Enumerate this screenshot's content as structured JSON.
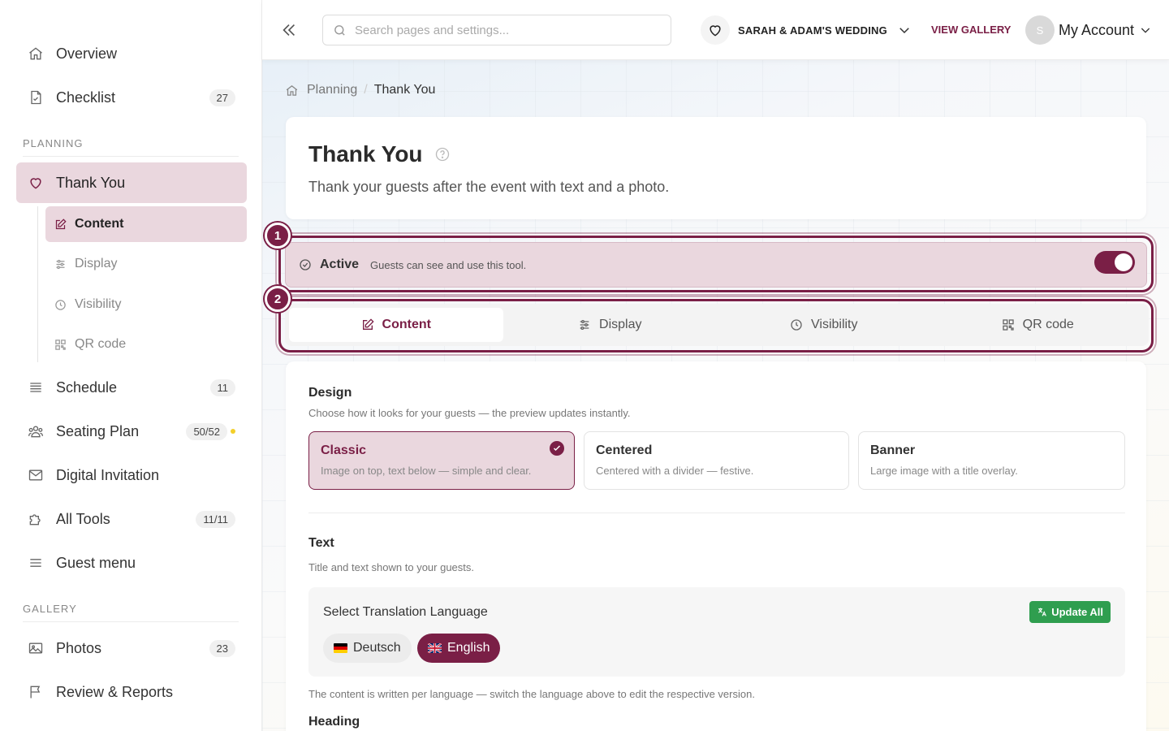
{
  "sidebar": {
    "top_items": [
      {
        "label": "Overview",
        "icon": "home-icon"
      },
      {
        "label": "Checklist",
        "icon": "checklist-icon",
        "badge": "27"
      }
    ],
    "planning_heading": "PLANNING",
    "thank_you": {
      "label": "Thank You",
      "icon": "heart-icon"
    },
    "sub_items": [
      {
        "label": "Content",
        "icon": "edit-icon"
      },
      {
        "label": "Display",
        "icon": "sliders-icon"
      },
      {
        "label": "Visibility",
        "icon": "clock-icon"
      },
      {
        "label": "QR code",
        "icon": "qr-icon"
      }
    ],
    "planning_items": [
      {
        "label": "Schedule",
        "icon": "list-icon",
        "badge": "11"
      },
      {
        "label": "Seating Plan",
        "icon": "users-icon",
        "badge": "50/52"
      },
      {
        "label": "Digital Invitation",
        "icon": "mail-icon"
      },
      {
        "label": "All Tools",
        "icon": "puzzle-icon",
        "badge": "11/11"
      },
      {
        "label": "Guest menu",
        "icon": "menu-icon"
      }
    ],
    "gallery_heading": "GALLERY",
    "gallery_items": [
      {
        "label": "Photos",
        "icon": "image-icon",
        "badge": "23"
      },
      {
        "label": "Review & Reports",
        "icon": "flag-icon"
      }
    ]
  },
  "topbar": {
    "search_placeholder": "Search pages and settings...",
    "event_name": "SARAH & ADAM'S WEDDING",
    "view_gallery": "VIEW GALLERY",
    "avatar_initial": "S",
    "account_label": "My Account"
  },
  "breadcrumb": {
    "items": [
      "Planning",
      "Thank You"
    ]
  },
  "header": {
    "title": "Thank You",
    "description": "Thank your guests after the event with text and a photo."
  },
  "callouts": [
    "1",
    "2"
  ],
  "active_bar": {
    "label": "Active",
    "hint": "Guests can see and use this tool.",
    "enabled": true
  },
  "tabs": [
    {
      "label": "Content",
      "icon": "edit-icon"
    },
    {
      "label": "Display",
      "icon": "sliders-icon"
    },
    {
      "label": "Visibility",
      "icon": "clock-icon"
    },
    {
      "label": "QR code",
      "icon": "qr-icon"
    }
  ],
  "design": {
    "title": "Design",
    "description": "Choose how it looks for your guests — the preview updates instantly.",
    "options": [
      {
        "title": "Classic",
        "desc": "Image on top, text below — simple and clear."
      },
      {
        "title": "Centered",
        "desc": "Centered with a divider — festive."
      },
      {
        "title": "Banner",
        "desc": "Large image with a title overlay."
      }
    ]
  },
  "text_section": {
    "title": "Text",
    "description": "Title and text shown to your guests.",
    "translation_title": "Select Translation Language",
    "update_all": "Update All",
    "languages": [
      "Deutsch",
      "English"
    ],
    "note": "The content is written per language — switch the language above to edit the respective version.",
    "heading_label": "Heading"
  },
  "colors": {
    "accent": "#7a1f46",
    "accent_light": "#ead7de",
    "success": "#2f9e4f"
  }
}
